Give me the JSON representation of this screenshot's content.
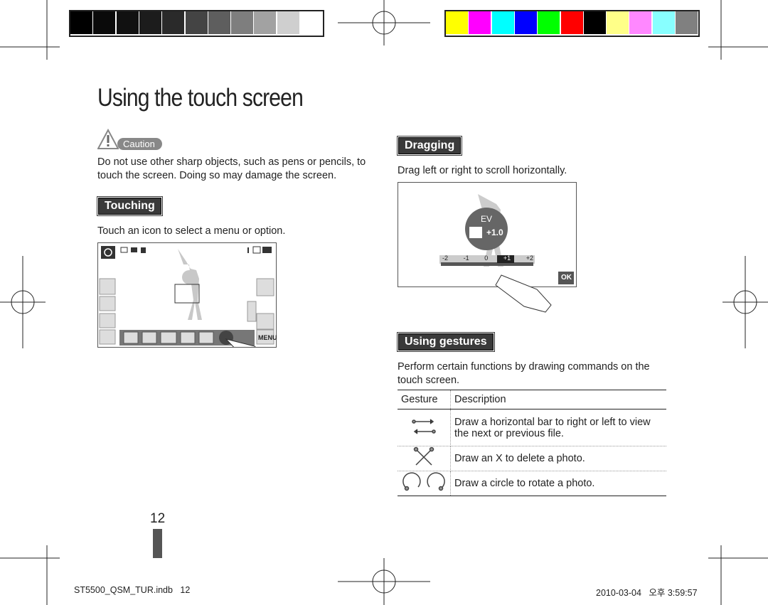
{
  "title": "Using the touch screen",
  "caution": {
    "label": "Caution",
    "text": "Do not use other sharp objects, such as pens or pencils, to touch the screen. Doing so may damage the screen."
  },
  "touching": {
    "heading": "Touching",
    "text": "Touch an icon to select a menu or option.",
    "screen": {
      "menu_label": "MENU"
    }
  },
  "dragging": {
    "heading": "Dragging",
    "text": "Drag left or right to scroll horizontally.",
    "screen": {
      "ev_label": "EV",
      "ev_value": "+1.0",
      "scale": [
        "-2",
        "-1",
        "0",
        "+1",
        "+2"
      ],
      "selected": "+1",
      "ok_label": "OK"
    }
  },
  "gestures": {
    "heading": "Using gestures",
    "text": "Perform certain functions by drawing commands on the touch screen.",
    "columns": [
      "Gesture",
      "Description"
    ],
    "rows": [
      {
        "icon": "horizontal-arrows-icon",
        "description": "Draw a horizontal bar to right or left to view the next or previous file."
      },
      {
        "icon": "x-gesture-icon",
        "description": "Draw an X to delete a photo."
      },
      {
        "icon": "circle-rotate-icon",
        "description": "Draw a circle to rotate a photo."
      }
    ]
  },
  "page_number": "12",
  "footer": {
    "file": "ST5500_QSM_TUR.indb   12",
    "timestamp": "2010-03-04   오후 3:59:57"
  },
  "colors": {
    "grayscale": [
      "#000000",
      "#0a0a0a",
      "#111111",
      "#1c1c1c",
      "#2a2a2a",
      "#444444",
      "#5e5e5e",
      "#7e7e7e",
      "#a2a2a2",
      "#cfcfcf",
      "#ffffff"
    ],
    "color_bar": [
      "#ffff00",
      "#ff00ff",
      "#00ffff",
      "#0000ff",
      "#00ff00",
      "#ff0000",
      "#000000",
      "#ffff88",
      "#ff88ff",
      "#88ffff",
      "#808080"
    ],
    "section_bg": "#3a3a3a"
  }
}
